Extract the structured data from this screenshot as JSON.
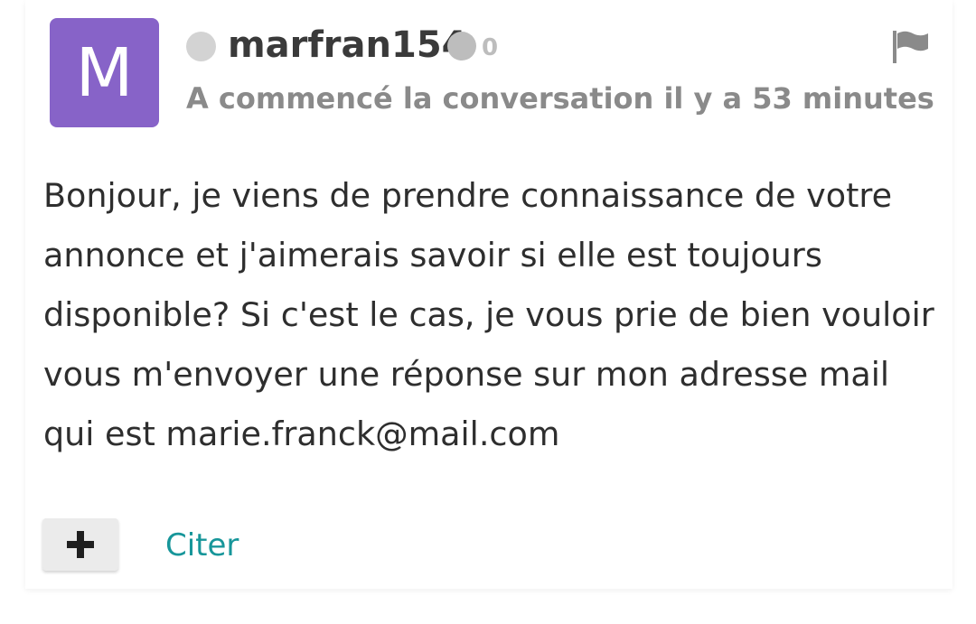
{
  "post": {
    "avatar_letter": "M",
    "avatar_color": "#8763c8",
    "username": "marfran154",
    "reputation": "0",
    "started_text": "A commencé la conversation il y a 53 minutes",
    "message": "Bonjour, je viens de prendre connaissance de votre annonce et j'aimerais savoir si elle est toujours disponible? Si c'est le cas, je vous prie de bien vouloir vous m'envoyer une réponse sur mon adresse mail qui est marie.franck@mail.com"
  },
  "actions": {
    "quote_label": "Citer"
  },
  "icons": {
    "flag": "flag-icon",
    "plus": "plus-icon",
    "status": "status-dot",
    "reputation": "reputation-dot"
  },
  "colors": {
    "link": "#17969a",
    "status_dot": "#d3d3d3",
    "reputation_dot": "#bdbdbd"
  }
}
